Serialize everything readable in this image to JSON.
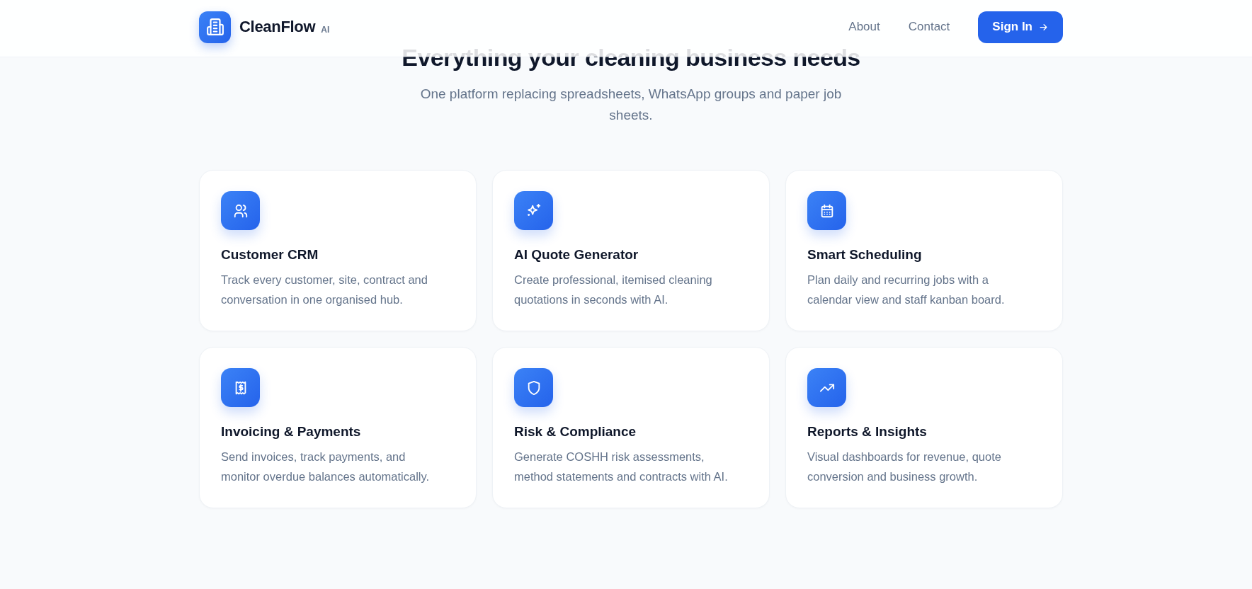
{
  "header": {
    "brand": "CleanFlow",
    "brand_badge": "AI",
    "nav": [
      "About",
      "Contact"
    ],
    "sign_in": "Sign In"
  },
  "section": {
    "title": "Everything your cleaning business needs",
    "subtitle": "One platform replacing spreadsheets, WhatsApp groups and paper job sheets."
  },
  "features": [
    {
      "kind": "users",
      "title": "Customer CRM",
      "text": "Track every customer, site, contract and conversation in one organised hub."
    },
    {
      "kind": "sparkle",
      "title": "AI Quote Generator",
      "text": "Create professional, itemised cleaning quotations in seconds with AI."
    },
    {
      "kind": "calendar",
      "title": "Smart Scheduling",
      "text": "Plan daily and recurring jobs with a calendar view and staff kanban board."
    },
    {
      "kind": "receipt",
      "title": "Invoicing & Payments",
      "text": "Send invoices, track payments, and monitor overdue balances automatically."
    },
    {
      "kind": "shield",
      "title": "Risk & Compliance",
      "text": "Generate COSHH risk assessments, method statements and contracts with AI."
    },
    {
      "kind": "trend",
      "title": "Reports & Insights",
      "text": "Visual dashboards for revenue, quote conversion and business growth."
    }
  ]
}
